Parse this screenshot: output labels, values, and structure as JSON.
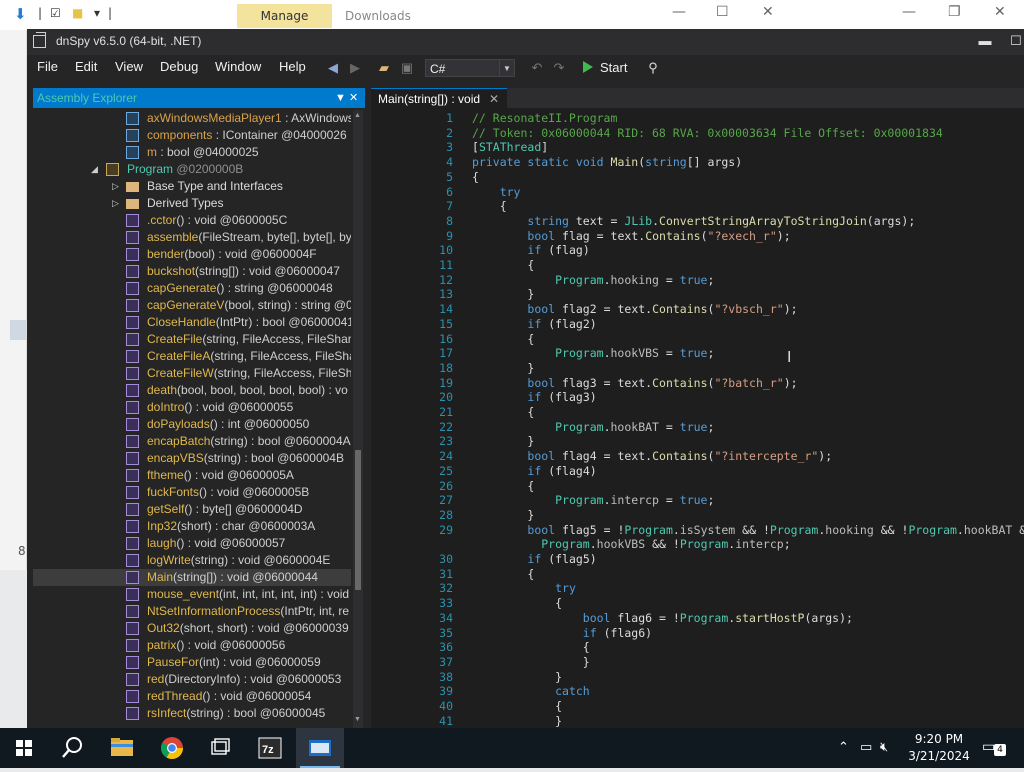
{
  "background_window": {
    "manage_label": "Manage",
    "downloads_label": "Downloads",
    "left_number": "8"
  },
  "app": {
    "title": "dnSpy v6.5.0 (64-bit, .NET)",
    "menu": [
      "File",
      "Edit",
      "View",
      "Debug",
      "Window",
      "Help"
    ],
    "language": "C#",
    "start_label": "Start"
  },
  "explorer": {
    "title": "Assembly Explorer",
    "rows": [
      {
        "name": "axWindowsMediaPlayer1",
        "rest": " : AxWindows",
        "kind": "field"
      },
      {
        "name": "components",
        "rest": " : IContainer @04000026",
        "kind": "field"
      },
      {
        "name": "m",
        "rest": " : bool @04000025",
        "kind": "field"
      },
      {
        "name": "Program",
        "rest": " @0200000B",
        "kind": "class"
      },
      {
        "name": "Base Type and Interfaces",
        "rest": "",
        "kind": "folder"
      },
      {
        "name": "Derived Types",
        "rest": "",
        "kind": "folder"
      },
      {
        "name": ".cctor",
        "rest": "() : void @0600005C",
        "kind": "method"
      },
      {
        "name": "assemble",
        "rest": "(FileStream, byte[], byte[], by",
        "kind": "method"
      },
      {
        "name": "bender",
        "rest": "(bool) : void @0600004F",
        "kind": "method"
      },
      {
        "name": "buckshot",
        "rest": "(string[]) : void @06000047",
        "kind": "method"
      },
      {
        "name": "capGenerate",
        "rest": "() : string @06000048",
        "kind": "method"
      },
      {
        "name": "capGenerateV",
        "rest": "(bool, string) : string @0",
        "kind": "method"
      },
      {
        "name": "CloseHandle",
        "rest": "(IntPtr) : bool @06000041",
        "kind": "method"
      },
      {
        "name": "CreateFile",
        "rest": "(string, FileAccess, FileShare,",
        "kind": "method"
      },
      {
        "name": "CreateFileA",
        "rest": "(string, FileAccess, FileShar",
        "kind": "method"
      },
      {
        "name": "CreateFileW",
        "rest": "(string, FileAccess, FileSha",
        "kind": "method"
      },
      {
        "name": "death",
        "rest": "(bool, bool, bool, bool, bool) : vo",
        "kind": "method"
      },
      {
        "name": "doIntro",
        "rest": "() : void @06000055",
        "kind": "method"
      },
      {
        "name": "doPayloads",
        "rest": "() : int @06000050",
        "kind": "method"
      },
      {
        "name": "encapBatch",
        "rest": "(string) : bool @0600004A",
        "kind": "method"
      },
      {
        "name": "encapVBS",
        "rest": "(string) : bool @0600004B",
        "kind": "method"
      },
      {
        "name": "ftheme",
        "rest": "() : void @0600005A",
        "kind": "method"
      },
      {
        "name": "fuckFonts",
        "rest": "() : void @0600005B",
        "kind": "method"
      },
      {
        "name": "getSelf",
        "rest": "() : byte[] @0600004D",
        "kind": "method"
      },
      {
        "name": "Inp32",
        "rest": "(short) : char @0600003A",
        "kind": "method"
      },
      {
        "name": "laugh",
        "rest": "() : void @06000057",
        "kind": "method"
      },
      {
        "name": "logWrite",
        "rest": "(string) : void @0600004E",
        "kind": "method"
      },
      {
        "name": "Main",
        "rest": "(string[]) : void @06000044",
        "kind": "method",
        "selected": true
      },
      {
        "name": "mouse_event",
        "rest": "(int, int, int, int, int) : void",
        "kind": "method"
      },
      {
        "name": "NtSetInformationProcess",
        "rest": "(IntPtr, int, re",
        "kind": "method"
      },
      {
        "name": "Out32",
        "rest": "(short, short) : void @06000039",
        "kind": "method"
      },
      {
        "name": "patrix",
        "rest": "() : void @06000056",
        "kind": "method"
      },
      {
        "name": "PauseFor",
        "rest": "(int) : void @06000059",
        "kind": "method"
      },
      {
        "name": "red",
        "rest": "(DirectoryInfo) : void @06000053",
        "kind": "method"
      },
      {
        "name": "redThread",
        "rest": "() : void @06000054",
        "kind": "method"
      },
      {
        "name": "rsInfect",
        "rest": "(string) : bool @06000045",
        "kind": "method"
      }
    ]
  },
  "editor": {
    "tab_label": "Main(string[]) : void",
    "lines": [
      {
        "n": "1",
        "t": "// ResonateII.Program"
      },
      {
        "n": "2",
        "t": "// Token: 0x06000044 RID: 68 RVA: 0x00003634 File Offset: 0x00001834"
      },
      {
        "n": "3",
        "t": "[STAThread]"
      },
      {
        "n": "4",
        "t": "private static void Main(string[] args)"
      },
      {
        "n": "5",
        "t": "{"
      },
      {
        "n": "6",
        "t": "    try"
      },
      {
        "n": "7",
        "t": "    {"
      },
      {
        "n": "8",
        "t": "        string text = JLib.ConvertStringArrayToStringJoin(args);"
      },
      {
        "n": "9",
        "t": "        bool flag = text.Contains(\"?exech_r\");"
      },
      {
        "n": "10",
        "t": "        if (flag)"
      },
      {
        "n": "11",
        "t": "        {"
      },
      {
        "n": "12",
        "t": "            Program.hooking = true;"
      },
      {
        "n": "13",
        "t": "        }"
      },
      {
        "n": "14",
        "t": "        bool flag2 = text.Contains(\"?vbsch_r\");"
      },
      {
        "n": "15",
        "t": "        if (flag2)"
      },
      {
        "n": "16",
        "t": "        {"
      },
      {
        "n": "17",
        "t": "            Program.hookVBS = true;"
      },
      {
        "n": "18",
        "t": "        }"
      },
      {
        "n": "19",
        "t": "        bool flag3 = text.Contains(\"?batch_r\");"
      },
      {
        "n": "20",
        "t": "        if (flag3)"
      },
      {
        "n": "21",
        "t": "        {"
      },
      {
        "n": "22",
        "t": "            Program.hookBAT = true;"
      },
      {
        "n": "23",
        "t": "        }"
      },
      {
        "n": "24",
        "t": "        bool flag4 = text.Contains(\"?intercepte_r\");"
      },
      {
        "n": "25",
        "t": "        if (flag4)"
      },
      {
        "n": "26",
        "t": "        {"
      },
      {
        "n": "27",
        "t": "            Program.intercp = true;"
      },
      {
        "n": "28",
        "t": "        }"
      },
      {
        "n": "29",
        "t": "        bool flag5 = !Program.isSystem && !Program.hooking && !Program.hookBAT && !"
      },
      {
        "n": "",
        "t": "          Program.hookVBS && !Program.intercp;"
      },
      {
        "n": "30",
        "t": "        if (flag5)"
      },
      {
        "n": "31",
        "t": "        {"
      },
      {
        "n": "32",
        "t": "            try"
      },
      {
        "n": "33",
        "t": "            {"
      },
      {
        "n": "34",
        "t": "                bool flag6 = !Program.startHostP(args);"
      },
      {
        "n": "35",
        "t": "                if (flag6)"
      },
      {
        "n": "36",
        "t": "                {"
      },
      {
        "n": "37",
        "t": "                }"
      },
      {
        "n": "38",
        "t": "            }"
      },
      {
        "n": "39",
        "t": "            catch"
      },
      {
        "n": "40",
        "t": "            {"
      },
      {
        "n": "41",
        "t": "            }"
      }
    ]
  },
  "taskbar": {
    "apps": [
      "start",
      "search",
      "file-explorer",
      "chrome",
      "task-view",
      "7zip",
      "dnspy"
    ],
    "time": "9:20 PM",
    "date": "3/21/2024",
    "notification_count": "4"
  },
  "colors": {
    "accent": "#007acc",
    "editor_bg": "#1e1e1e",
    "keyword": "#569cd6",
    "type": "#4ec9b0",
    "string": "#d69d85",
    "comment": "#57a64a"
  }
}
